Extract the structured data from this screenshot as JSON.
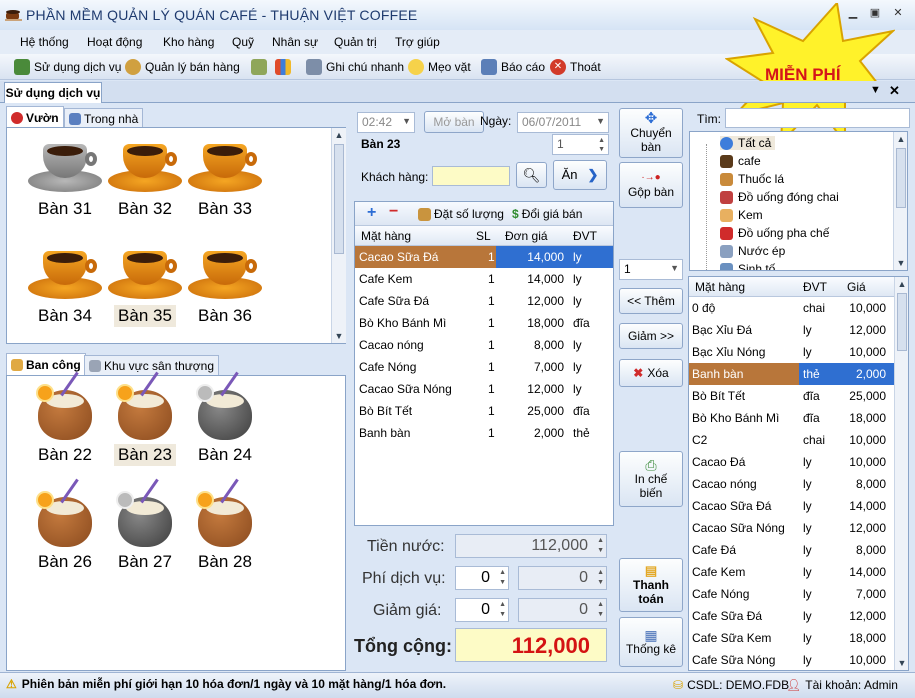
{
  "window": {
    "title": "PHẦN MỀM QUẢN LÝ QUÁN CAFÉ - THUẬN VIỆT COFFEE"
  },
  "menu": [
    "Hệ thống",
    "Hoạt động",
    "Kho hàng",
    "Quỹ",
    "Nhân sự",
    "Quản trị",
    "Trợ giúp"
  ],
  "toolbar": {
    "use_service": "Sử dụng dịch vụ",
    "sales_mgmt": "Quản lý bán hàng",
    "quick_note": "Ghi chú nhanh",
    "tips": "Mẹo vặt",
    "report": "Báo cáo",
    "exit": "Thoát"
  },
  "promo": "MIỄN PHÍ",
  "doc_tab": "Sử dụng dịch vụ",
  "area_top": {
    "tabs": [
      "Vườn",
      "Trong nhà"
    ],
    "tables": [
      "Bàn 31",
      "Bàn 32",
      "Bàn 33",
      "Bàn 34",
      "Bàn 35",
      "Bàn 36"
    ]
  },
  "area_bottom": {
    "tabs": [
      "Ban công",
      "Khu vực sân thượng"
    ],
    "tables": [
      "Bàn 22",
      "Bàn 23",
      "Bàn 24",
      "Bàn 26",
      "Bàn 27",
      "Bàn 28"
    ]
  },
  "order": {
    "time": "02:42",
    "open_button": "Mở bàn",
    "date_label": "Ngày:",
    "date": "06/07/2011",
    "table_name": "Bàn 23",
    "guest_count": "1",
    "customer_label": "Khách hàng:",
    "eat_button": "Ăn",
    "set_qty": "Đặt số lượng",
    "change_price": "Đổi giá bán"
  },
  "order_grid": {
    "headers": [
      "Mặt hàng",
      "SL",
      "Đơn giá",
      "ĐVT"
    ],
    "rows": [
      [
        "Cacao Sữa Đá",
        "1",
        "14,000",
        "ly"
      ],
      [
        "Cafe Kem",
        "1",
        "14,000",
        "ly"
      ],
      [
        "Cafe Sữa Đá",
        "1",
        "12,000",
        "ly"
      ],
      [
        "Bò Kho Bánh Mì",
        "1",
        "18,000",
        "đĩa"
      ],
      [
        "Cacao nóng",
        "1",
        "8,000",
        "ly"
      ],
      [
        "Cafe Nóng",
        "1",
        "7,000",
        "ly"
      ],
      [
        "Cacao Sữa Nóng",
        "1",
        "12,000",
        "ly"
      ],
      [
        "Bò Bít Tết",
        "1",
        "25,000",
        "đĩa"
      ],
      [
        "Banh bàn",
        "1",
        "2,000",
        "thẻ"
      ]
    ]
  },
  "totals": {
    "drink_label": "Tiền nước:",
    "drink_value": "112,000",
    "service_label": "Phí dịch vụ:",
    "service_pct": "0",
    "service_value": "0",
    "discount_label": "Giảm giá:",
    "discount_pct": "0",
    "discount_value": "0",
    "total_label": "Tổng cộng:",
    "total_value": "112,000"
  },
  "actions": {
    "move": "Chuyển bàn",
    "merge": "Gộp bàn",
    "qty": "1",
    "add": "<< Thêm",
    "reduce": "Giảm >>",
    "delete": "Xóa",
    "print": "In chế biến",
    "pay": "Thanh toán",
    "stats": "Thống kê"
  },
  "search_label": "Tìm:",
  "categories": [
    "Tất cả",
    "cafe",
    "Thuốc lá",
    "Đồ uống đóng chai",
    "Kem",
    "Đồ uống pha chế",
    "Nước ép",
    "Sinh tố"
  ],
  "menu_grid": {
    "headers": [
      "Mặt hàng",
      "ĐVT",
      "Giá"
    ],
    "rows": [
      [
        "0 độ",
        "chai",
        "10,000"
      ],
      [
        "Bạc Xỉu Đá",
        "ly",
        "12,000"
      ],
      [
        "Bạc Xỉu Nóng",
        "ly",
        "10,000"
      ],
      [
        "Banh bàn",
        "thẻ",
        "2,000"
      ],
      [
        "Bò Bít Tết",
        "đĩa",
        "25,000"
      ],
      [
        "Bò Kho Bánh Mì",
        "đĩa",
        "18,000"
      ],
      [
        "C2",
        "chai",
        "10,000"
      ],
      [
        "Cacao Đá",
        "ly",
        "10,000"
      ],
      [
        "Cacao nóng",
        "ly",
        "8,000"
      ],
      [
        "Cacao Sữa Đá",
        "ly",
        "14,000"
      ],
      [
        "Cacao Sữa Nóng",
        "ly",
        "12,000"
      ],
      [
        "Cafe Đá",
        "ly",
        "8,000"
      ],
      [
        "Cafe Kem",
        "ly",
        "14,000"
      ],
      [
        "Cafe Nóng",
        "ly",
        "7,000"
      ],
      [
        "Cafe Sữa Đá",
        "ly",
        "12,000"
      ],
      [
        "Cafe Sữa Kem",
        "ly",
        "18,000"
      ],
      [
        "Cafe Sữa Nóng",
        "ly",
        "10,000"
      ]
    ]
  },
  "status": {
    "message": "Phiên bản miễn phí giới hạn 10 hóa đơn/1 ngày và 10 mặt hàng/1 hóa đơn.",
    "db": "CSDL: DEMO.FDB",
    "account": "Tài khoản: Admin"
  }
}
